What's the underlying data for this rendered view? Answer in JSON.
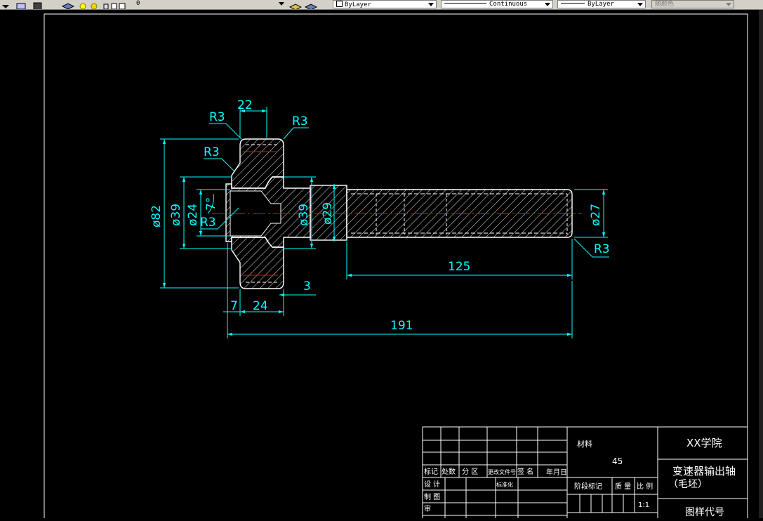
{
  "toolbar": {
    "layer_value": "0",
    "color_value": "ByLayer",
    "linetype_value": "Continuous",
    "lineweight_value": "ByLayer",
    "plotstyle_value": "随颜色"
  },
  "drawing": {
    "dimensions": {
      "d22": "22",
      "r3_top_left": "R3",
      "r3_top_right": "R3",
      "r3_mid": "R3",
      "r3_inner": "R3",
      "r3_shaft_end": "R3",
      "angle_7": "7°",
      "dia82": "ø82",
      "dia39_outer": "ø39",
      "dia24": "ø24",
      "dia39_inner": "ø39",
      "dia29": "ø29",
      "dia27": "ø27",
      "d125": "125",
      "d191": "191",
      "d7": "7",
      "d24": "24",
      "d3": "3"
    },
    "colors": {
      "dimension": "#00ffff",
      "outline": "#ffffff",
      "centerline": "#ff0000"
    }
  },
  "title_block": {
    "material_label": "材料",
    "material_value": "45",
    "school": "XX学院",
    "part_name_line1": "变速器输出轴",
    "part_name_line2": "（毛坯）",
    "rev_mark": "标记",
    "rev_count": "处数",
    "rev_zone": "分 区",
    "rev_doc": "更改文件号",
    "rev_sign": "签 名",
    "rev_date": "年月日",
    "design": "设 计",
    "standardize": "标准化",
    "drafting": "制 图",
    "review": "审",
    "stage_mark": "阶段标记",
    "weight": "质 量",
    "scale_label": "比 例",
    "scale_value": "1:1",
    "drawing_code": "图样代号"
  }
}
